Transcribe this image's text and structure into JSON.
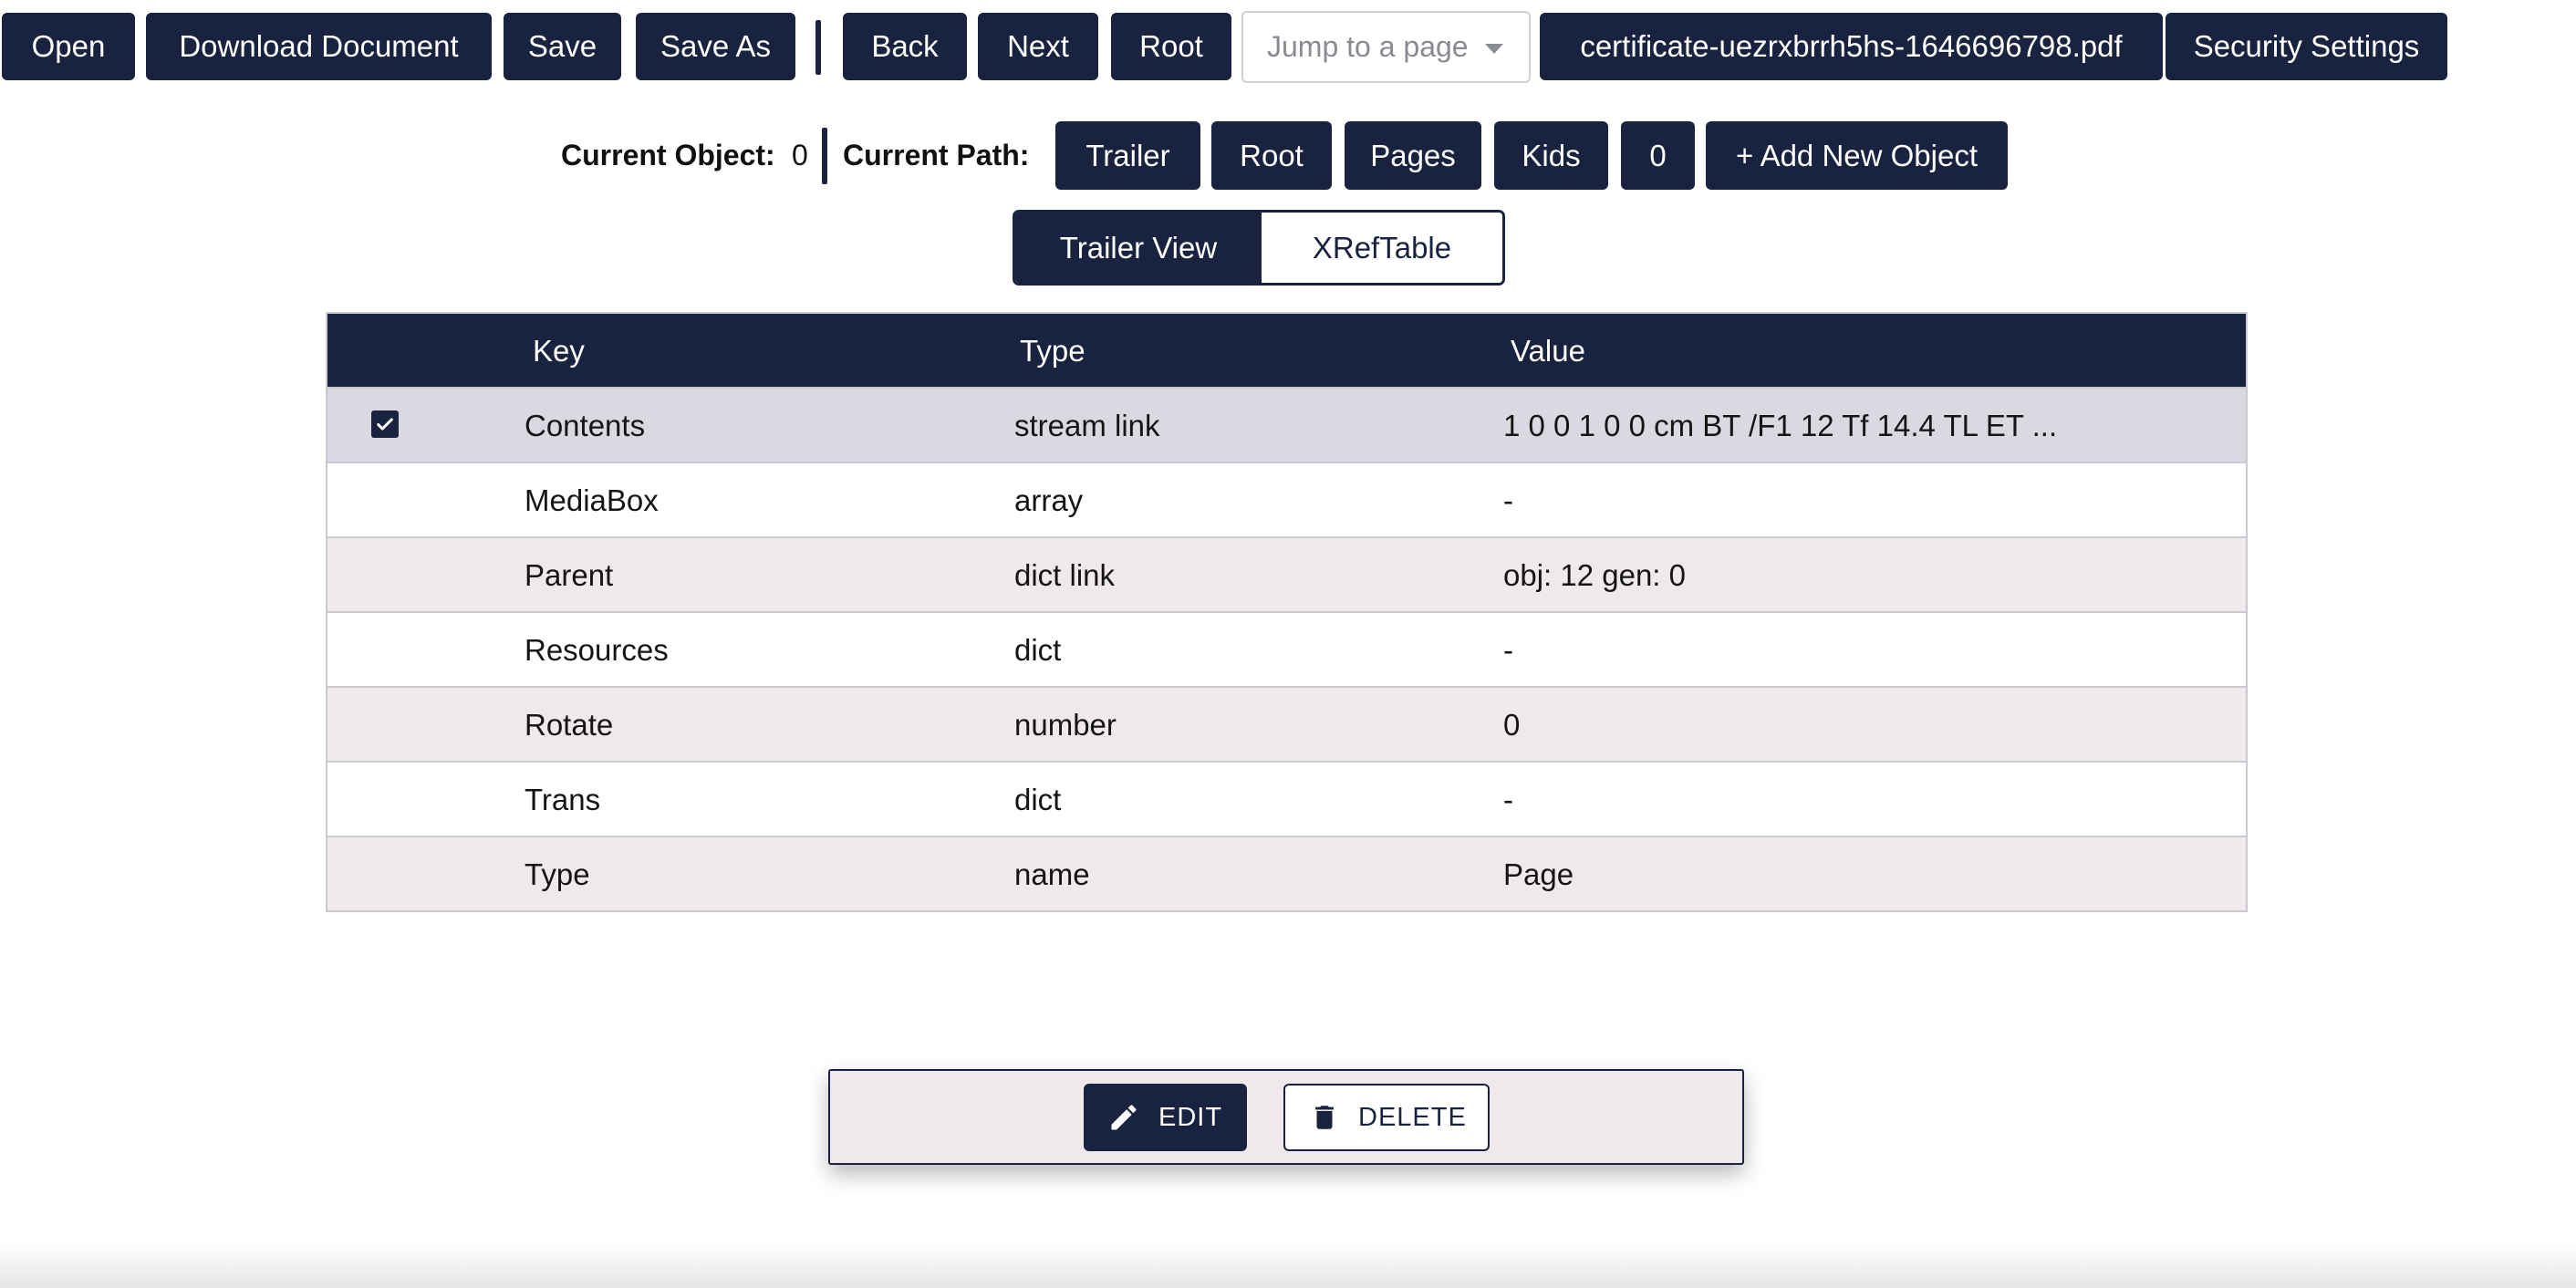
{
  "toolbar": {
    "open_label": "Open",
    "download_label": "Download Document",
    "save_label": "Save",
    "save_as_label": "Save As",
    "back_label": "Back",
    "next_label": "Next",
    "root_label": "Root",
    "jump_placeholder": "Jump to a page",
    "filename": "certificate-uezrxbrrh5hs-1646696798.pdf",
    "security_label": "Security Settings"
  },
  "path_bar": {
    "current_object_label": "Current Object:",
    "current_object_value": "0",
    "current_path_label": "Current Path:",
    "path_items": [
      "Trailer",
      "Root",
      "Pages",
      "Kids",
      "0"
    ],
    "add_object_label": "+ Add New Object"
  },
  "view_toggle": {
    "trailer_view": "Trailer View",
    "xref_table": "XRefTable",
    "active": "Trailer View"
  },
  "table": {
    "headers": {
      "key": "Key",
      "type": "Type",
      "value": "Value"
    },
    "rows": [
      {
        "key": "Contents",
        "type": "stream link",
        "value": "1 0 0 1 0 0 cm BT /F1 12 Tf 14.4 TL ET ...",
        "selected": true
      },
      {
        "key": "MediaBox",
        "type": "array",
        "value": "-",
        "selected": false
      },
      {
        "key": "Parent",
        "type": "dict link",
        "value": "obj: 12 gen: 0",
        "selected": false
      },
      {
        "key": "Resources",
        "type": "dict",
        "value": "-",
        "selected": false
      },
      {
        "key": "Rotate",
        "type": "number",
        "value": "0",
        "selected": false
      },
      {
        "key": "Trans",
        "type": "dict",
        "value": "-",
        "selected": false
      },
      {
        "key": "Type",
        "type": "name",
        "value": "Page",
        "selected": false
      }
    ]
  },
  "actions": {
    "edit_label": "EDIT",
    "delete_label": "DELETE"
  },
  "colors": {
    "primary": "#19223f",
    "row_alt": "#efe9eb",
    "row_selected": "#dbd8e2"
  },
  "icons": {
    "checkbox": "check-icon",
    "edit": "pencil-icon",
    "delete": "trash-icon",
    "select": "caret-down-icon"
  }
}
